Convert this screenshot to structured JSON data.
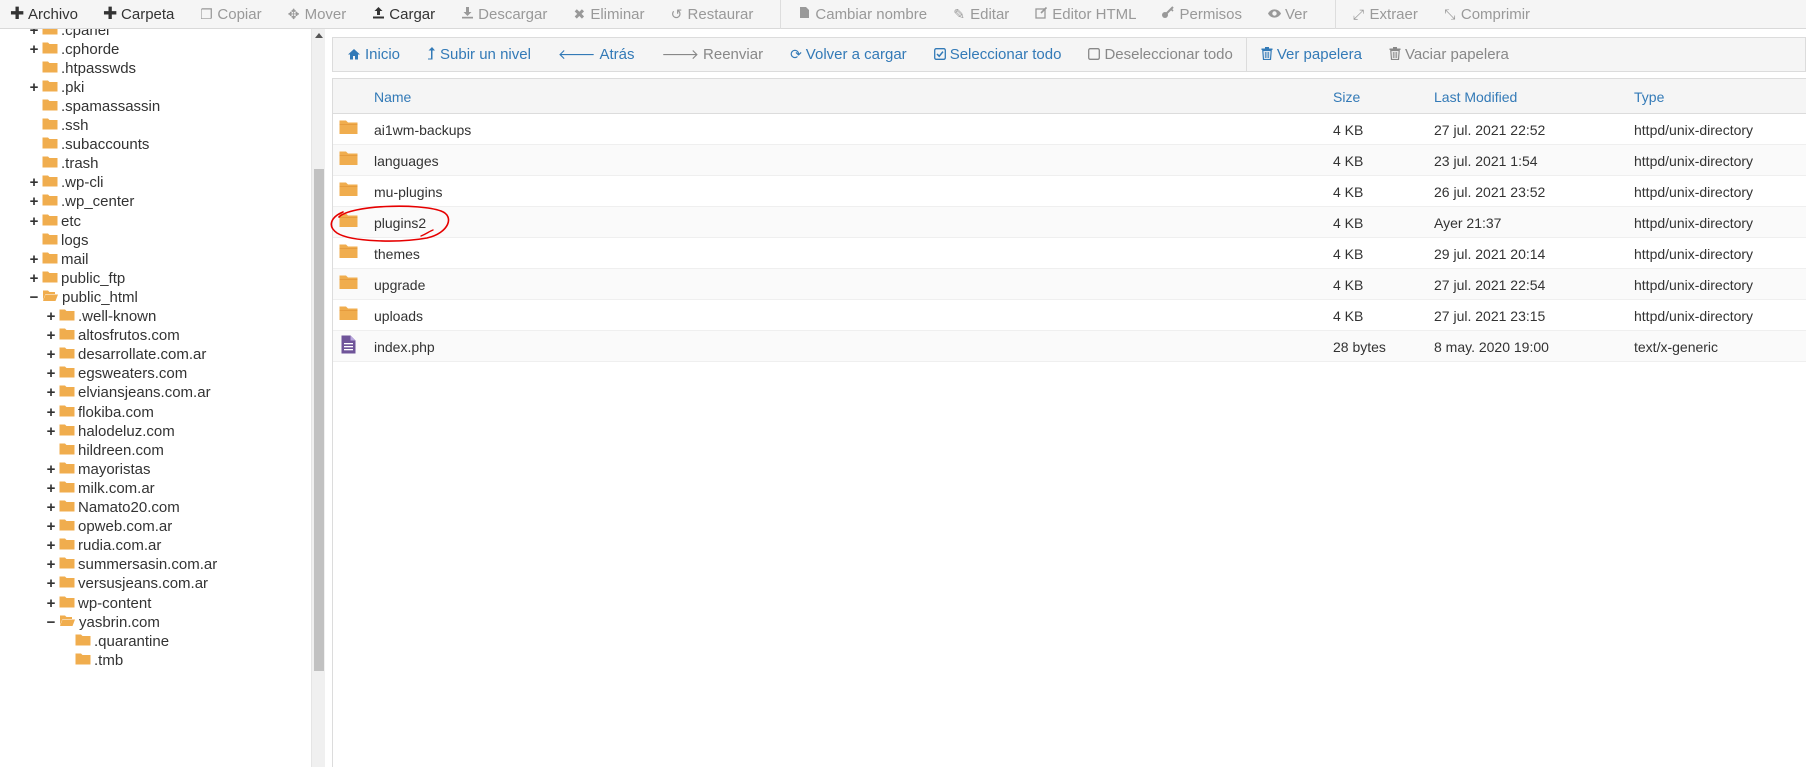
{
  "toolbar": {
    "items": [
      {
        "label": "Archivo",
        "icon": "plus-icon",
        "enabled": true
      },
      {
        "label": "Carpeta",
        "icon": "plus-icon",
        "enabled": true
      },
      {
        "label": "Copiar",
        "icon": "copy-icon",
        "enabled": false
      },
      {
        "label": "Mover",
        "icon": "move-icon",
        "enabled": false
      },
      {
        "label": "Cargar",
        "icon": "upload-icon",
        "enabled": true
      },
      {
        "label": "Descargar",
        "icon": "download-icon",
        "enabled": false
      },
      {
        "label": "Eliminar",
        "icon": "times-icon",
        "enabled": false
      },
      {
        "label": "Restaurar",
        "icon": "undo-icon",
        "enabled": false
      },
      {
        "label": "Cambiar nombre",
        "icon": "file-icon",
        "enabled": false
      },
      {
        "label": "Editar",
        "icon": "pencil-icon",
        "enabled": false
      },
      {
        "label": "Editor HTML",
        "icon": "edit-icon",
        "enabled": false
      },
      {
        "label": "Permisos",
        "icon": "key-icon",
        "enabled": false
      },
      {
        "label": "Ver",
        "icon": "eye-icon",
        "enabled": false
      },
      {
        "label": "Extraer",
        "icon": "expand-icon",
        "enabled": false
      },
      {
        "label": "Comprimir",
        "icon": "compress-icon",
        "enabled": false
      }
    ]
  },
  "navbar": {
    "items": [
      {
        "label": "Inicio",
        "icon": "home-icon",
        "enabled": true
      },
      {
        "label": "Subir un nivel",
        "icon": "level-up-icon",
        "enabled": true
      },
      {
        "label": "Atrás",
        "icon": "arrow-left-icon",
        "enabled": true
      },
      {
        "label": "Reenviar",
        "icon": "arrow-right-icon",
        "enabled": false
      },
      {
        "label": "Volver a cargar",
        "icon": "refresh-icon",
        "enabled": true
      },
      {
        "label": "Seleccionar todo",
        "icon": "check-square-icon",
        "enabled": true
      },
      {
        "label": "Deseleccionar todo",
        "icon": "square-icon",
        "enabled": false
      },
      {
        "label": "Ver papelera",
        "icon": "trash-icon",
        "enabled": true
      },
      {
        "label": "Vaciar papelera",
        "icon": "trash-icon",
        "enabled": false
      }
    ]
  },
  "tree": {
    "items": [
      {
        "label": ".cpanel",
        "expander": "+",
        "depth": 1
      },
      {
        "label": ".cphorde",
        "expander": "+",
        "depth": 1
      },
      {
        "label": ".htpasswds",
        "expander": "",
        "depth": 1
      },
      {
        "label": ".pki",
        "expander": "+",
        "depth": 1
      },
      {
        "label": ".spamassassin",
        "expander": "",
        "depth": 1
      },
      {
        "label": ".ssh",
        "expander": "",
        "depth": 1
      },
      {
        "label": ".subaccounts",
        "expander": "",
        "depth": 1
      },
      {
        "label": ".trash",
        "expander": "",
        "depth": 1
      },
      {
        "label": ".wp-cli",
        "expander": "+",
        "depth": 1
      },
      {
        "label": ".wp_center",
        "expander": "+",
        "depth": 1
      },
      {
        "label": "etc",
        "expander": "+",
        "depth": 1
      },
      {
        "label": "logs",
        "expander": "",
        "depth": 1
      },
      {
        "label": "mail",
        "expander": "+",
        "depth": 1
      },
      {
        "label": "public_ftp",
        "expander": "+",
        "depth": 1
      },
      {
        "label": "public_html",
        "expander": "−",
        "depth": 1,
        "open": true
      },
      {
        "label": ".well-known",
        "expander": "+",
        "depth": 2
      },
      {
        "label": "altosfrutos.com",
        "expander": "+",
        "depth": 2
      },
      {
        "label": "desarrollate.com.ar",
        "expander": "+",
        "depth": 2
      },
      {
        "label": "egsweaters.com",
        "expander": "+",
        "depth": 2
      },
      {
        "label": "elviansjeans.com.ar",
        "expander": "+",
        "depth": 2
      },
      {
        "label": "flokiba.com",
        "expander": "+",
        "depth": 2
      },
      {
        "label": "halodeluz.com",
        "expander": "+",
        "depth": 2
      },
      {
        "label": "hildreen.com",
        "expander": "",
        "depth": 2
      },
      {
        "label": "mayoristas",
        "expander": "+",
        "depth": 2
      },
      {
        "label": "milk.com.ar",
        "expander": "+",
        "depth": 2
      },
      {
        "label": "Namato20.com",
        "expander": "+",
        "depth": 2
      },
      {
        "label": "opweb.com.ar",
        "expander": "+",
        "depth": 2
      },
      {
        "label": "rudia.com.ar",
        "expander": "+",
        "depth": 2
      },
      {
        "label": "summersasin.com.ar",
        "expander": "+",
        "depth": 2
      },
      {
        "label": "versusjeans.com.ar",
        "expander": "+",
        "depth": 2
      },
      {
        "label": "wp-content",
        "expander": "+",
        "depth": 2
      },
      {
        "label": "yasbrin.com",
        "expander": "−",
        "depth": 2,
        "open": true
      },
      {
        "label": ".quarantine",
        "expander": "",
        "depth": 3
      },
      {
        "label": ".tmb",
        "expander": "",
        "depth": 3
      }
    ]
  },
  "table": {
    "headers": {
      "name": "Name",
      "size": "Size",
      "modified": "Last Modified",
      "type": "Type"
    },
    "rows": [
      {
        "name": "ai1wm-backups",
        "size": "4 KB",
        "modified": "27 jul. 2021 22:52",
        "type": "httpd/unix-directory",
        "kind": "folder"
      },
      {
        "name": "languages",
        "size": "4 KB",
        "modified": "23 jul. 2021 1:54",
        "type": "httpd/unix-directory",
        "kind": "folder"
      },
      {
        "name": "mu-plugins",
        "size": "4 KB",
        "modified": "26 jul. 2021 23:52",
        "type": "httpd/unix-directory",
        "kind": "folder"
      },
      {
        "name": "plugins2",
        "size": "4 KB",
        "modified": "Ayer 21:37",
        "type": "httpd/unix-directory",
        "kind": "folder"
      },
      {
        "name": "themes",
        "size": "4 KB",
        "modified": "29 jul. 2021 20:14",
        "type": "httpd/unix-directory",
        "kind": "folder"
      },
      {
        "name": "upgrade",
        "size": "4 KB",
        "modified": "27 jul. 2021 22:54",
        "type": "httpd/unix-directory",
        "kind": "folder"
      },
      {
        "name": "uploads",
        "size": "4 KB",
        "modified": "27 jul. 2021 23:15",
        "type": "httpd/unix-directory",
        "kind": "folder"
      },
      {
        "name": "index.php",
        "size": "28 bytes",
        "modified": "8 may. 2020 19:00",
        "type": "text/x-generic",
        "kind": "file"
      }
    ]
  },
  "colors": {
    "link": "#337ab7",
    "folder": "#f0ad4e",
    "file": "#6f5499",
    "annotation": "#e60000",
    "disabled": "#999999"
  }
}
